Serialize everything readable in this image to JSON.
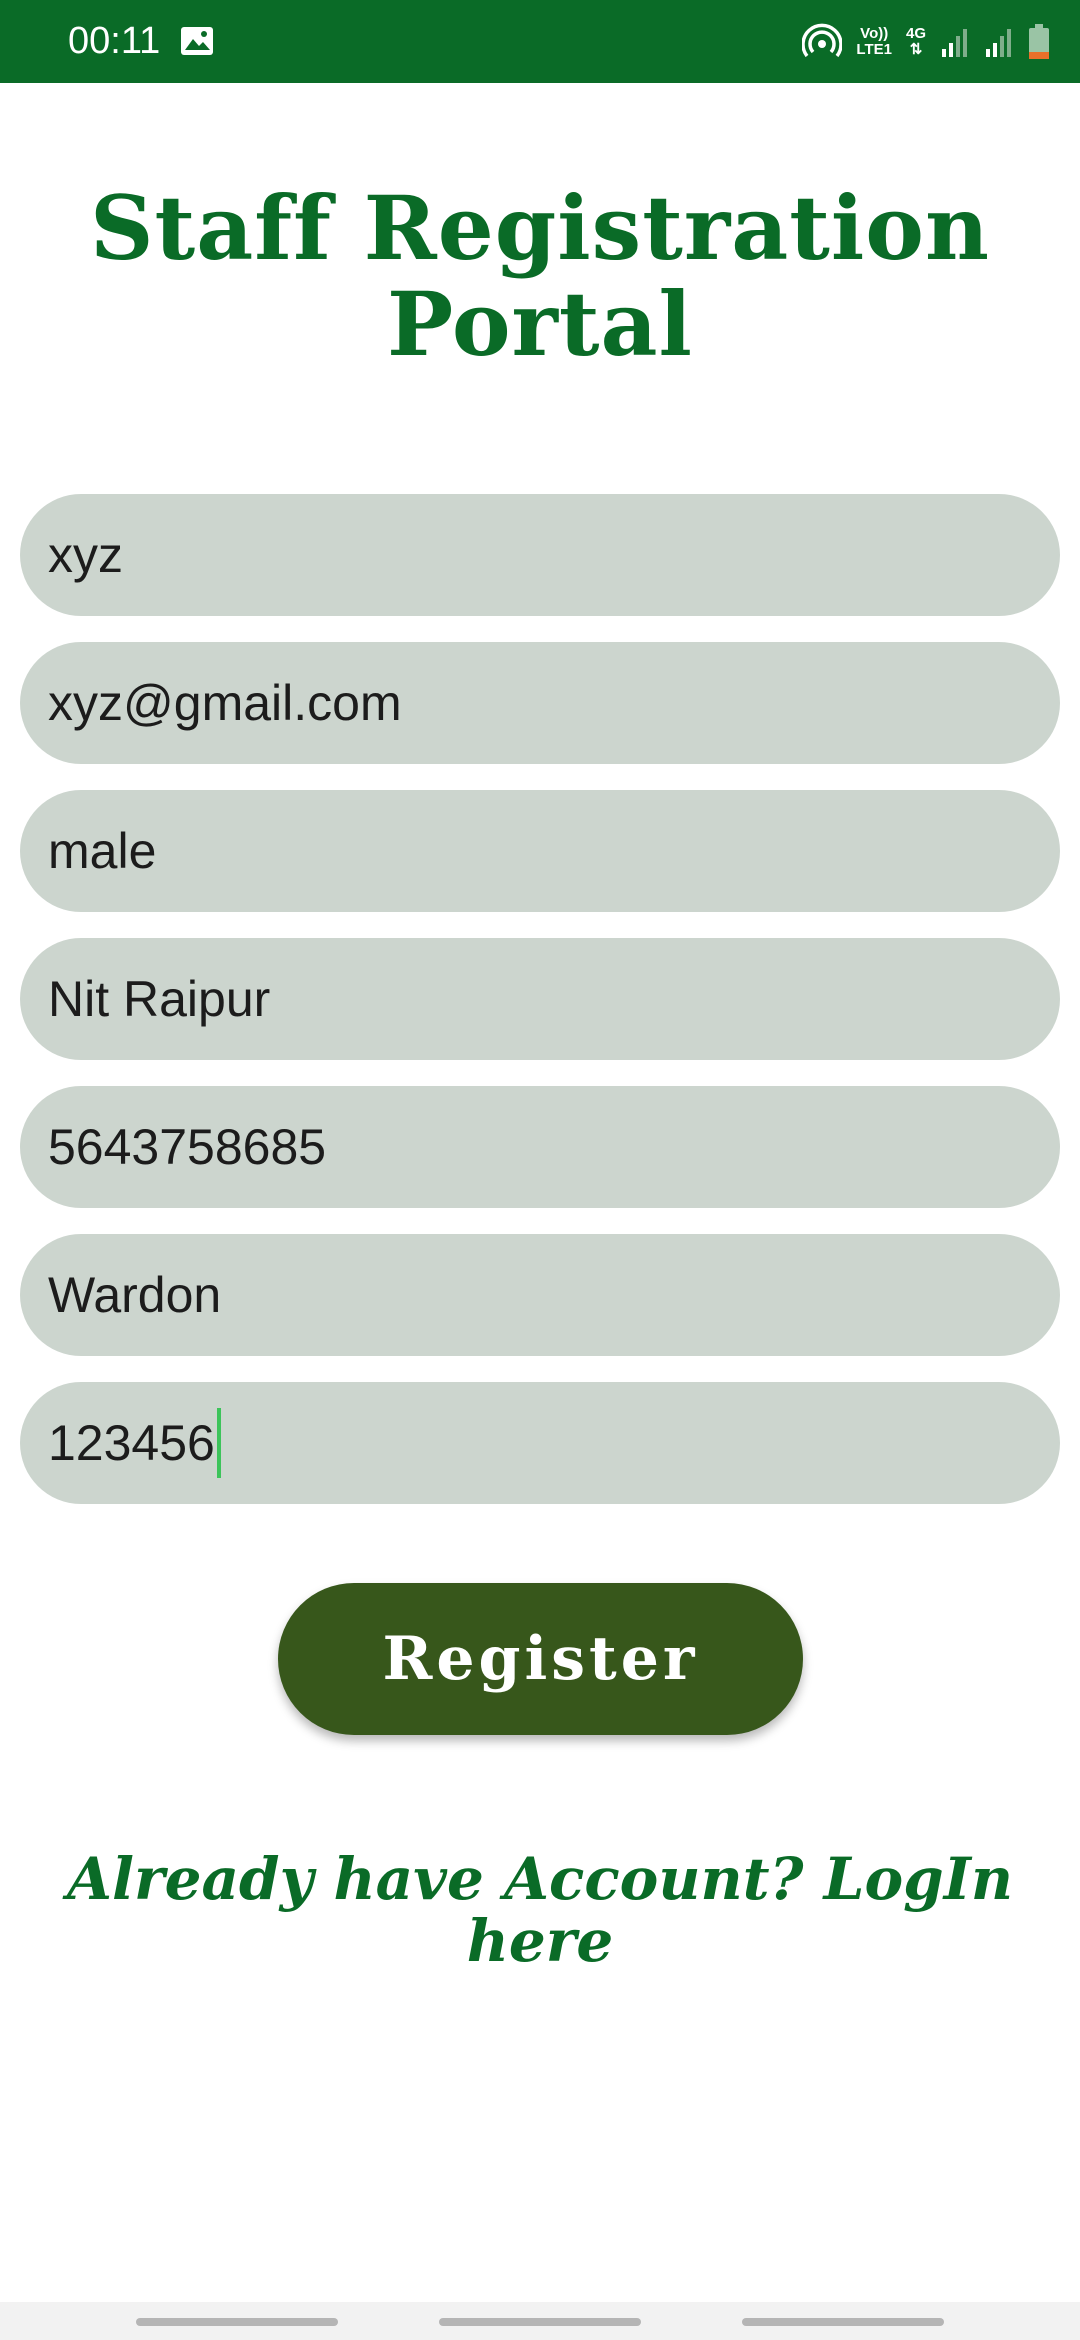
{
  "status_bar": {
    "time": "00:11",
    "volte_line1": "Vo))",
    "volte_line2": "LTE1",
    "network": "4G",
    "background_color": "#0a6b27",
    "battery_level": 0.2
  },
  "page": {
    "title_line1": "Staff Registration",
    "title_line2": "Portal"
  },
  "form": {
    "fields": [
      {
        "value": "xyz"
      },
      {
        "value": "xyz@gmail.com"
      },
      {
        "value": "male"
      },
      {
        "value": "Nit Raipur"
      },
      {
        "value": "5643758685"
      },
      {
        "value": "Wardon"
      },
      {
        "value": "123456"
      }
    ],
    "field_background": "#ccd5ce",
    "register_label": "Register",
    "register_color": "#37571b"
  },
  "login_link": {
    "line1": "Already have Account? LogIn",
    "line2": "here"
  },
  "colors": {
    "accent": "#0a6b27",
    "caret": "#3cc45a"
  }
}
